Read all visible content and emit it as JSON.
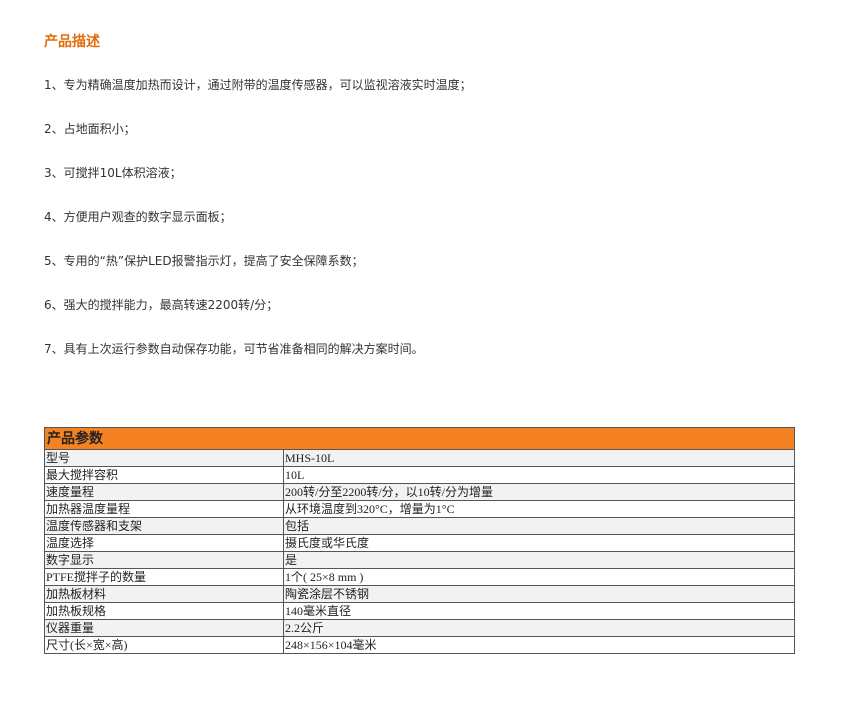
{
  "description": {
    "title": "产品描述",
    "items": [
      "1、专为精确温度加热而设计，通过附带的温度传感器，可以监视溶液实时温度；",
      "2、占地面积小；",
      "3、可搅拌10L体积溶液；",
      "4、方便用户观查的数字显示面板；",
      "5、专用的“热”保护LED报警指示灯，提高了安全保障系数；",
      "6、强大的搅拌能力，最高转速2200转/分；",
      "7、具有上次运行参数自动保存功能，可节省准备相同的解决方案时间。"
    ]
  },
  "params": {
    "title": "产品参数",
    "rows": [
      {
        "name": "型号",
        "value": "MHS-10L"
      },
      {
        "name": "最大搅拌容积",
        "value": "10L"
      },
      {
        "name": "速度量程",
        "value": "200转/分至2200转/分，以10转/分为增量"
      },
      {
        "name": "加热器温度量程",
        "value": "从环境温度到320°C，增量为1°C"
      },
      {
        "name": "温度传感器和支架",
        "value": "包括"
      },
      {
        "name": "温度选择",
        "value": "摄氏度或华氏度"
      },
      {
        "name": "数字显示",
        "value": "是"
      },
      {
        "name": "PTFE搅拌子的数量",
        "value": "1个( 25×8 mm )"
      },
      {
        "name": "加热板材料",
        "value": "陶瓷涂层不锈钢"
      },
      {
        "name": "加热板规格",
        "value": "140毫米直径"
      },
      {
        "name": "仪器重量",
        "value": "2.2公斤"
      },
      {
        "name": "尺寸(长×宽×高)",
        "value": "248×156×104毫米"
      }
    ]
  }
}
